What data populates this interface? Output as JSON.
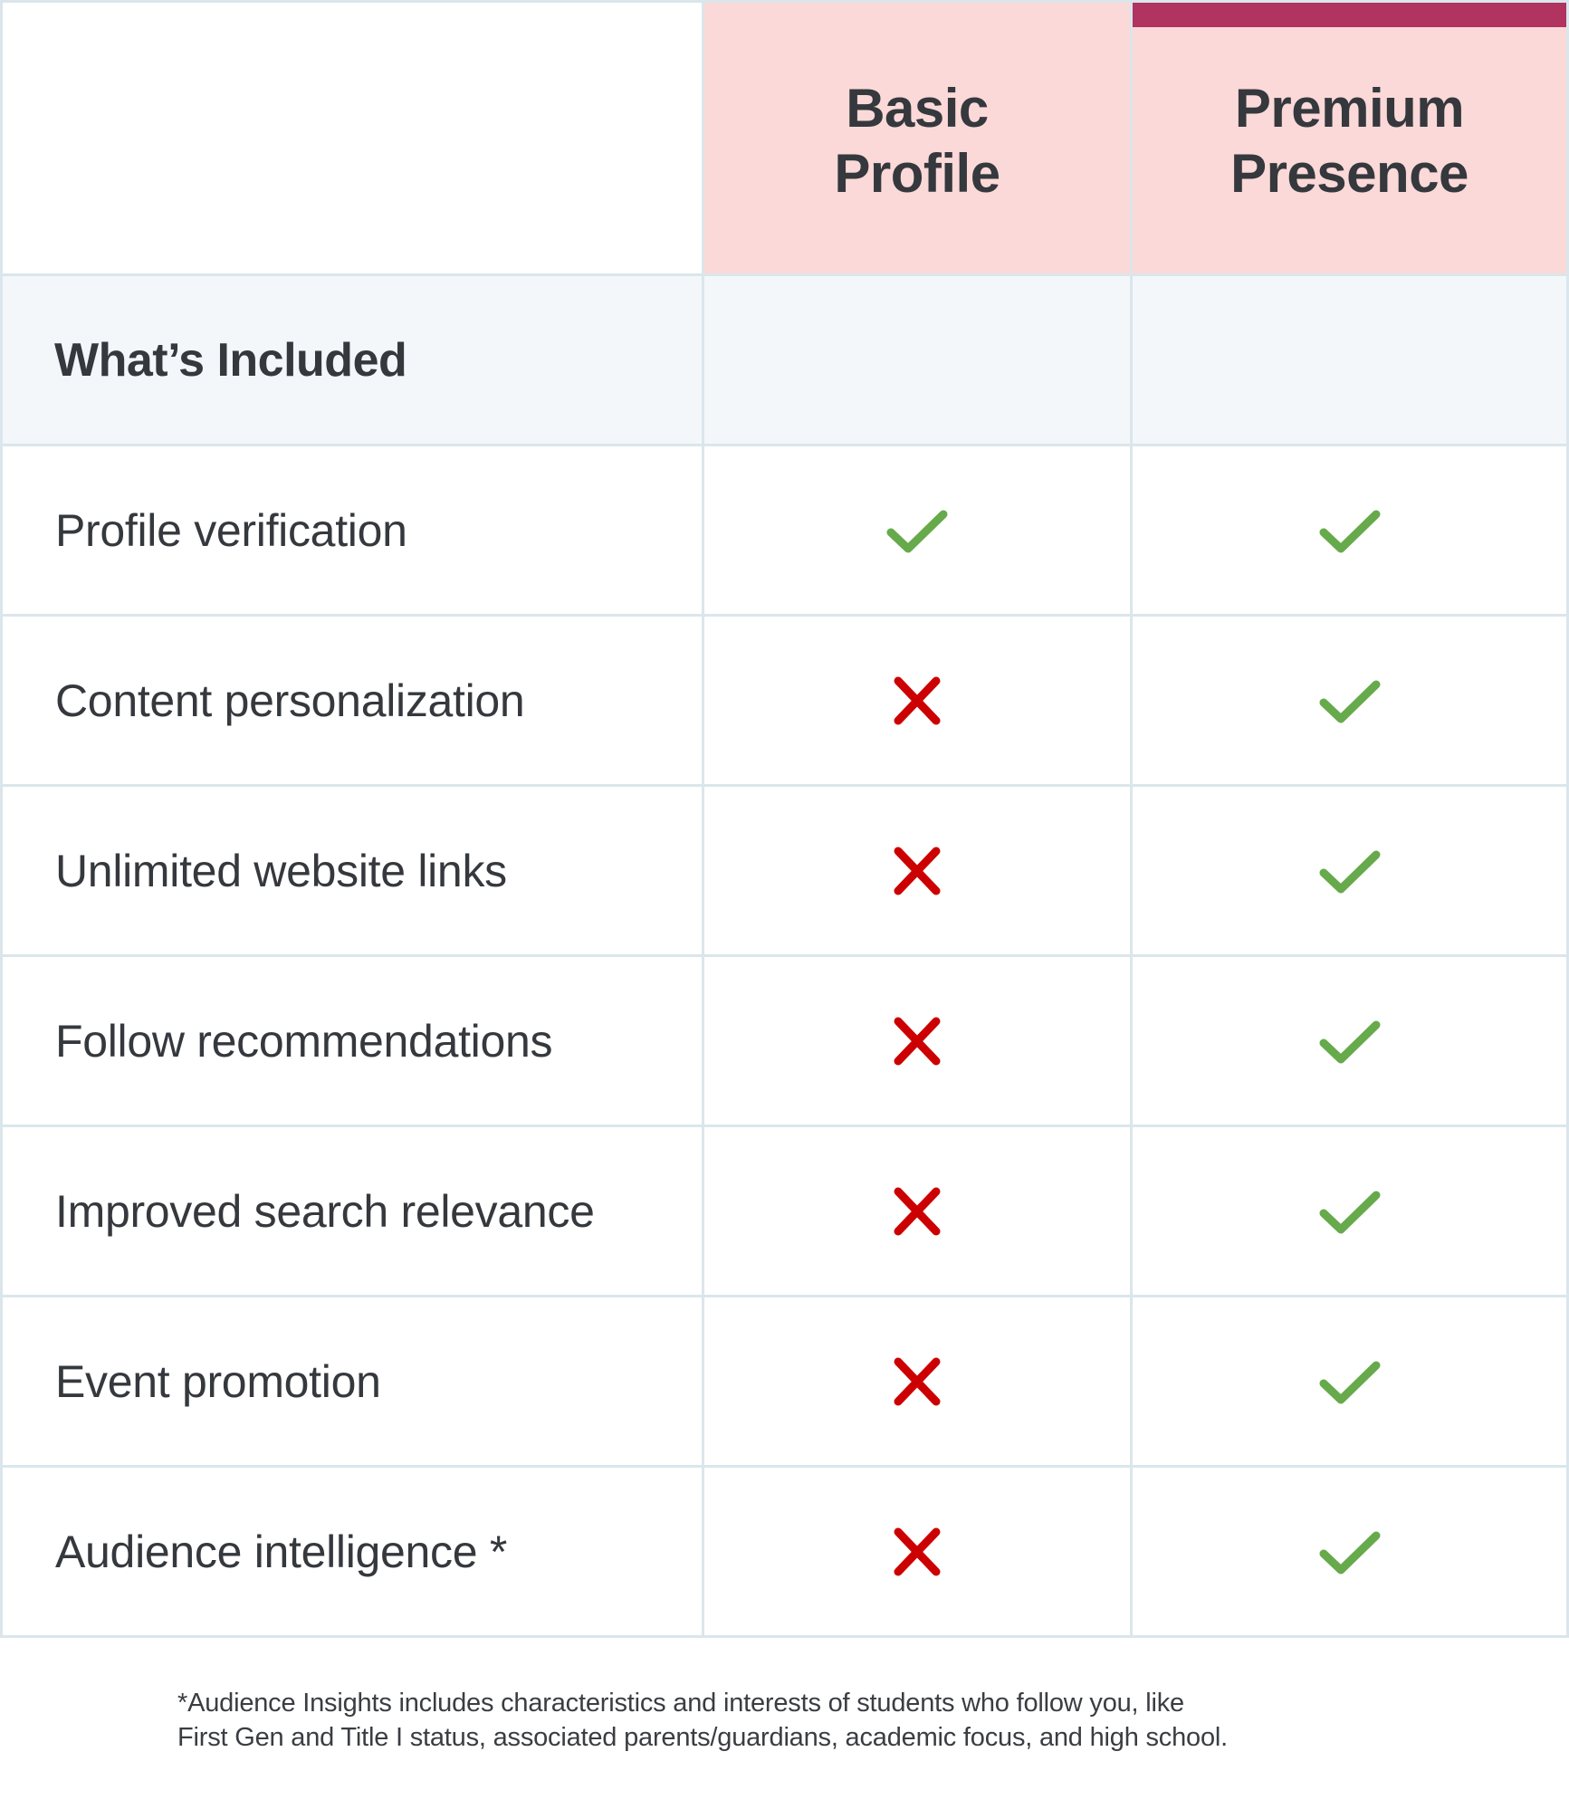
{
  "header": {
    "corner_label": "",
    "plans": [
      {
        "line1": "Basic",
        "line2": "Profile",
        "highlight": false
      },
      {
        "line1": "Premium",
        "line2": "Presence",
        "highlight": true
      }
    ]
  },
  "section": {
    "title": "What’s Included"
  },
  "features": [
    {
      "label": "Profile verification",
      "basic": "check",
      "premium": "check"
    },
    {
      "label": "Content personalization",
      "basic": "cross",
      "premium": "check"
    },
    {
      "label": "Unlimited website links",
      "basic": "cross",
      "premium": "check"
    },
    {
      "label": "Follow recommendations",
      "basic": "cross",
      "premium": "check"
    },
    {
      "label": "Improved search relevance",
      "basic": "cross",
      "premium": "check"
    },
    {
      "label": "Event promotion",
      "basic": "cross",
      "premium": "check"
    },
    {
      "label": "Audience intelligence *",
      "basic": "cross",
      "premium": "check"
    }
  ],
  "footnote": {
    "line1": "*Audience Insights includes characteristics and interests of students who follow you, like",
    "line2": "First Gen and Title I status, associated parents/guardians, academic focus, and high school."
  },
  "colors": {
    "plan_header_bg": "#fad9d8",
    "premium_accent": "#b03360",
    "section_bg": "#f3f7fa",
    "grid_line": "#dbe6ec",
    "check": "#66aa4b",
    "cross": "#cc0000",
    "text": "#35383d"
  },
  "icons": {
    "check": "check-icon",
    "cross": "cross-icon"
  }
}
